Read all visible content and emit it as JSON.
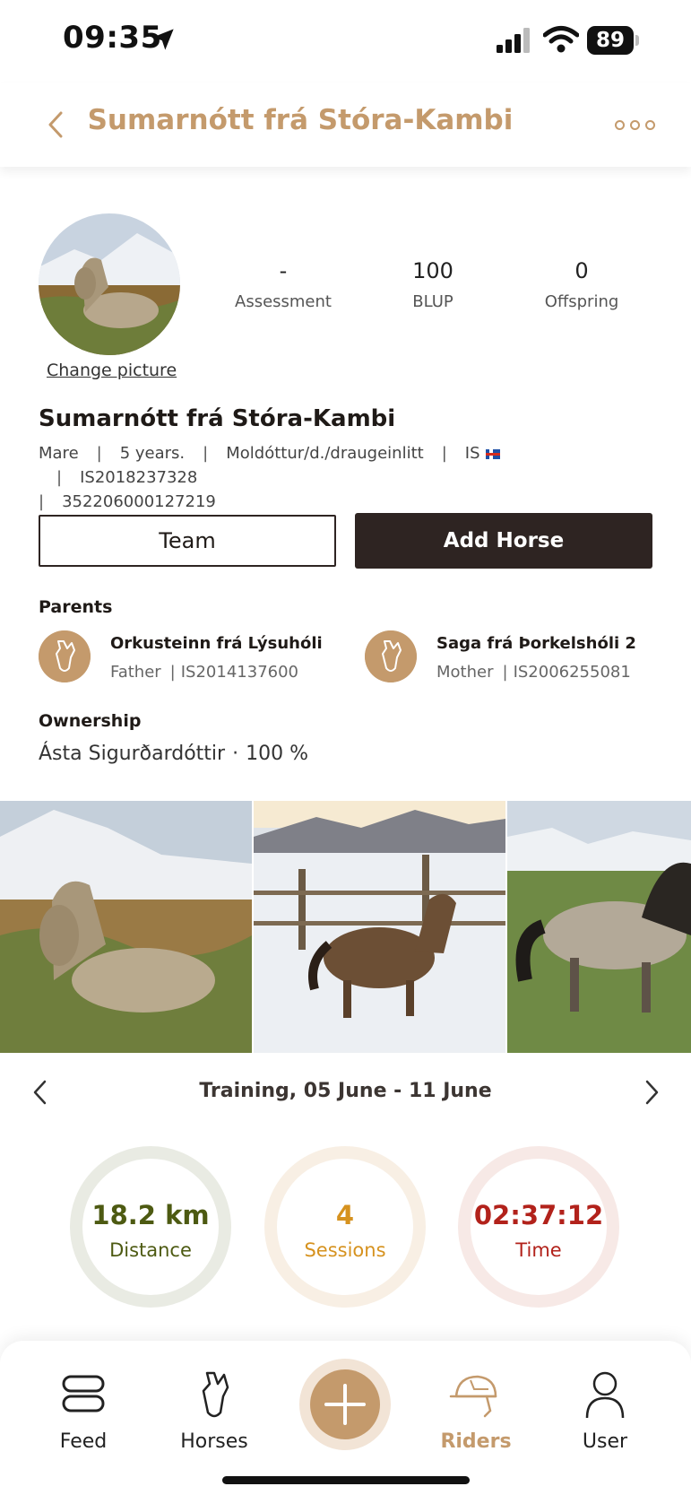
{
  "status_bar": {
    "time": "09:35",
    "battery": "89"
  },
  "nav": {
    "title": "Sumarnótt frá Stóra-Kambi"
  },
  "profile": {
    "change_picture": "Change picture",
    "stats": [
      {
        "value": "-",
        "label": "Assessment"
      },
      {
        "value": "100",
        "label": "BLUP"
      },
      {
        "value": "0",
        "label": "Offspring"
      }
    ],
    "name": "Sumarnótt frá Stóra-Kambi",
    "meta": {
      "sex": "Mare",
      "age": "5 years.",
      "color": "Moldóttur/d./draugeinlitt",
      "country": "IS",
      "feif_id": "IS2018237328",
      "microchip": "352206000127219"
    }
  },
  "actions": {
    "team": "Team",
    "add_horse": "Add Horse"
  },
  "parents": {
    "heading": "Parents",
    "father": {
      "name": "Orkusteinn frá Lýsuhóli",
      "role": "Father",
      "id": "IS2014137600"
    },
    "mother": {
      "name": "Saga frá Þorkelshóli 2",
      "role": "Mother",
      "id": "IS2006255081"
    }
  },
  "ownership": {
    "heading": "Ownership",
    "owner": "Ásta Sigurðardóttir",
    "share": "100 %"
  },
  "training": {
    "title": "Training, 05 June - 11 June",
    "distance": {
      "value": "18.2 km",
      "label": "Distance",
      "color": "#4d5a12",
      "ring": "#e9ebe3"
    },
    "sessions": {
      "value": "4",
      "label": "Sessions",
      "color": "#d6921f",
      "ring": "#f8efe4"
    },
    "time": {
      "value": "02:37:12",
      "label": "Time",
      "color": "#b2221b",
      "ring": "#f7e9e6"
    }
  },
  "tabs": {
    "feed": "Feed",
    "horses": "Horses",
    "riders": "Riders",
    "user": "User"
  },
  "colors": {
    "accent": "#c49a6c",
    "dark": "#2e2422"
  }
}
